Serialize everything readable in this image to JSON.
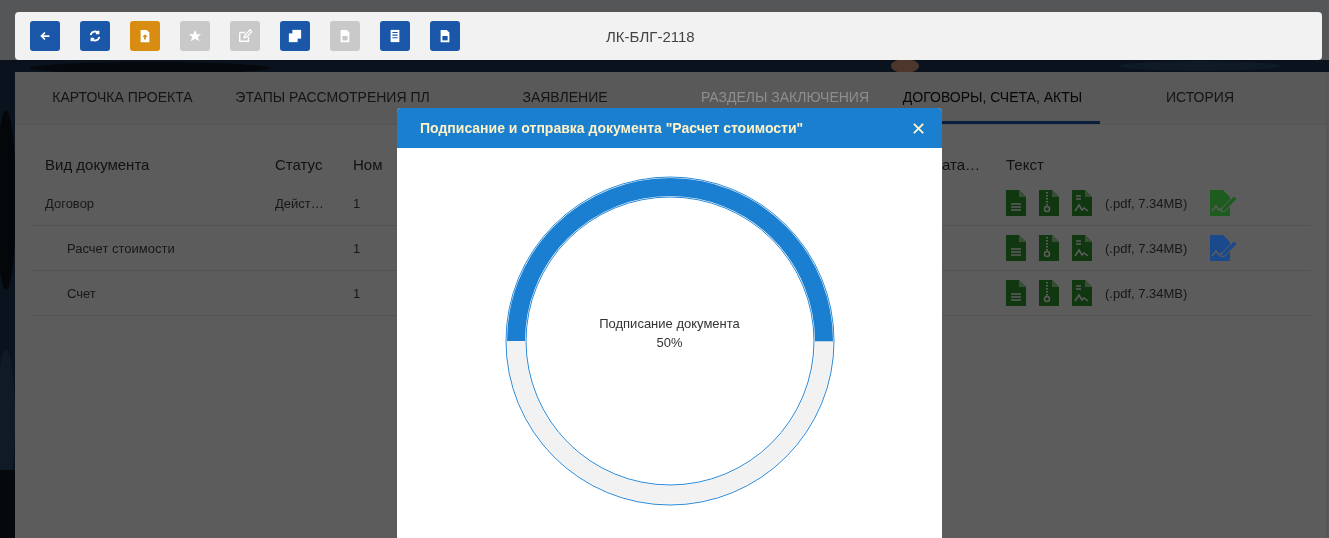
{
  "toolbar": {
    "buttons": [
      {
        "kind": "back",
        "disabled": false
      },
      {
        "kind": "refresh",
        "disabled": false
      },
      {
        "kind": "upload",
        "disabled": false
      },
      {
        "kind": "star",
        "disabled": true
      },
      {
        "kind": "edit",
        "disabled": true
      },
      {
        "kind": "copy",
        "disabled": false
      },
      {
        "kind": "sheet",
        "disabled": true
      },
      {
        "kind": "doc",
        "disabled": false
      },
      {
        "kind": "word",
        "disabled": false
      }
    ],
    "title": "ЛК-БЛГ-2118"
  },
  "tabs": [
    {
      "label": "КАРТОЧКА ПРОЕКТА",
      "selected": false,
      "disabled": false
    },
    {
      "label": "ЭТАПЫ РАССМОТРЕНИЯ ПЛ",
      "selected": false,
      "disabled": false
    },
    {
      "label": "ЗАЯВЛЕНИЕ",
      "selected": false,
      "disabled": false
    },
    {
      "label": "РАЗДЕЛЫ ЗАКЛЮЧЕНИЯ",
      "selected": false,
      "disabled": true
    },
    {
      "label": "ДОГОВОРЫ, СЧЕТА, АКТЫ",
      "selected": true,
      "disabled": false
    },
    {
      "label": "ИСТОРИЯ",
      "selected": false,
      "disabled": false
    }
  ],
  "table": {
    "columns": {
      "left": [
        "Вид документа",
        "Статус",
        "Ном"
      ],
      "right": [
        "ата…",
        "Текст"
      ]
    },
    "rows": [
      {
        "name": "Договор",
        "status": "Дейст…",
        "number": "1",
        "file": "(.pdf, 7.34MB)",
        "signature": {
          "color": "#1e5b1e"
        },
        "children": [
          {
            "name": "Расчет стоимости",
            "number": "1",
            "file": "(.pdf, 7.34MB)",
            "signature": {
              "color": "#1a4a8c"
            }
          },
          {
            "name": "Счет",
            "number": "1",
            "file": "(.pdf, 7.34MB)"
          }
        ]
      }
    ]
  },
  "dialog": {
    "title": "Подписание и отправка документа \"Расчет стоимости\"",
    "close": "✕",
    "progress": {
      "label": "Подписание документа",
      "reading": "50%",
      "level": 0.5
    }
  }
}
